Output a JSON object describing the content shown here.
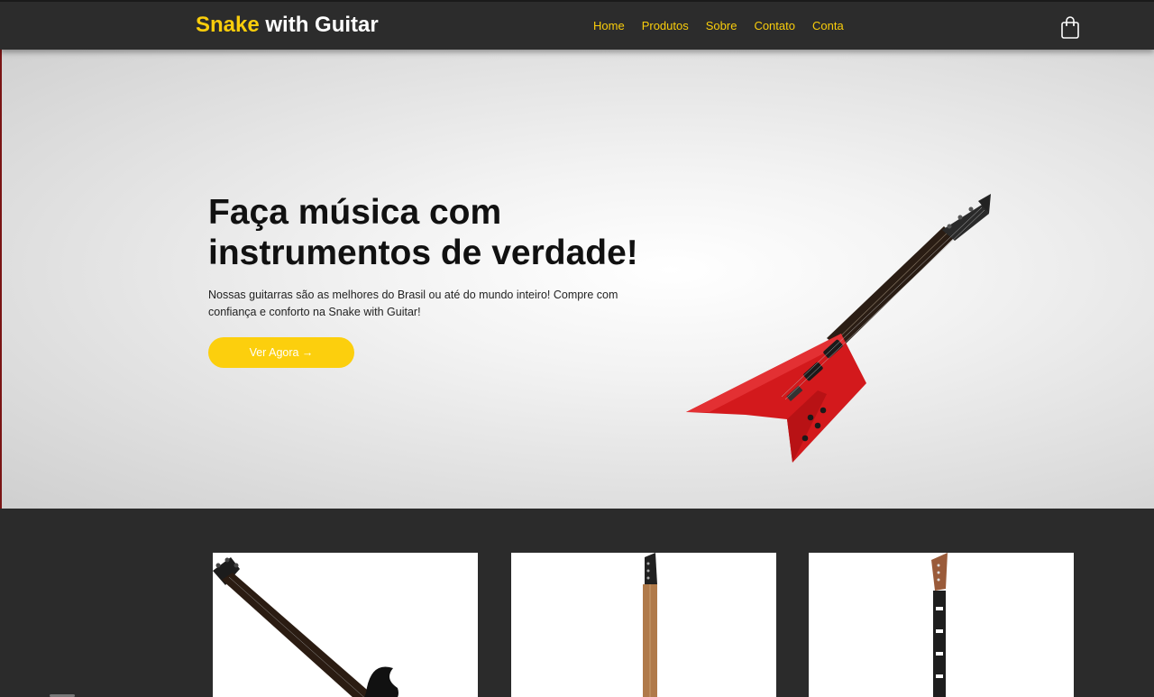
{
  "header": {
    "brand_highlight": "Snake",
    "brand_rest": " with Guitar",
    "nav": [
      {
        "label": "Home"
      },
      {
        "label": "Produtos"
      },
      {
        "label": "Sobre"
      },
      {
        "label": "Contato"
      },
      {
        "label": "Conta"
      }
    ],
    "cart_icon": "shopping-bag-icon"
  },
  "hero": {
    "title": "Faça música com instrumentos de verdade!",
    "text": "Nossas guitarras são as melhores do Brasil ou até do mundo inteiro! Compre com confiança e conforto na Snake with Guitar!",
    "button_label": "Ver Agora →",
    "image": "red-flying-v-guitar"
  },
  "products": [
    {
      "image": "black-bc-rich-guitar"
    },
    {
      "image": "natural-finish-guitar-neck"
    },
    {
      "image": "mahogany-guitar-neck"
    }
  ],
  "colors": {
    "accent": "#f9cd0b",
    "nav_bg": "#2c2c2c",
    "guitar_red": "#d3191c"
  }
}
